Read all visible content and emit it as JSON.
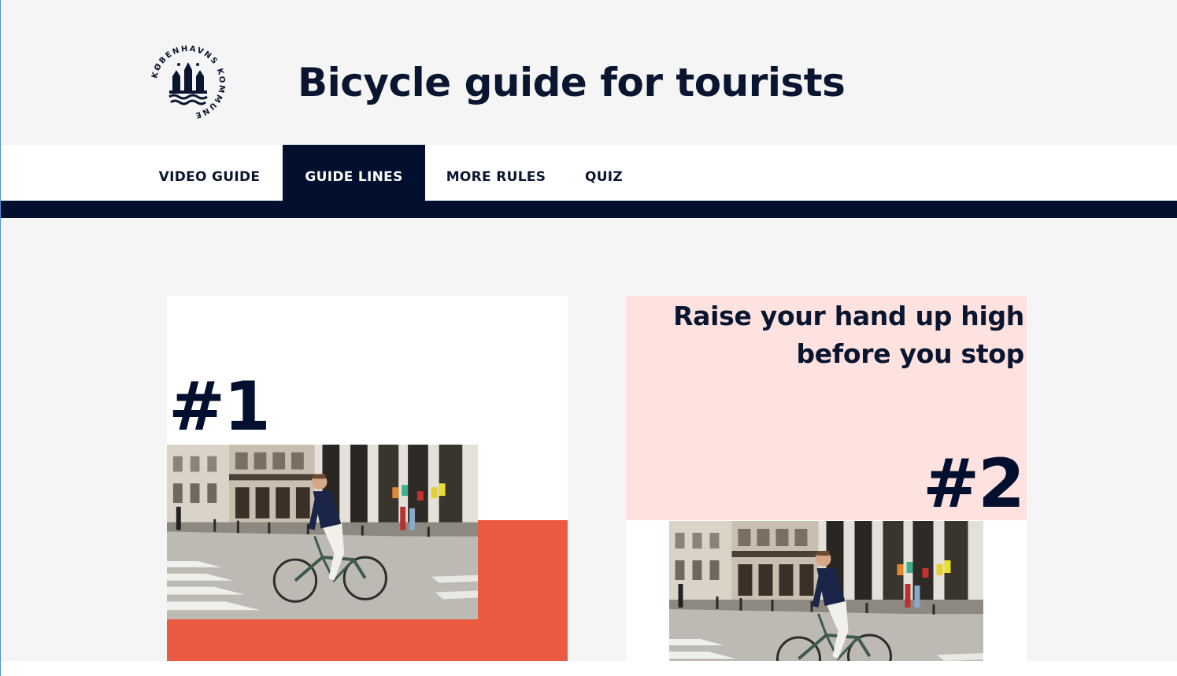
{
  "header": {
    "title": "Bicycle guide for tourists",
    "logo_text": "KØBENHAVNS KOMMUNE"
  },
  "nav": {
    "tabs": [
      {
        "label": "VIDEO GUIDE",
        "active": false
      },
      {
        "label": "GUIDE LINES",
        "active": true
      },
      {
        "label": "MORE RULES",
        "active": false
      },
      {
        "label": "QUIZ",
        "active": false
      }
    ]
  },
  "cards": [
    {
      "number": "#1",
      "text": "",
      "image": "cyclist-photo"
    },
    {
      "number": "#2",
      "text_line1": "Raise your hand up high",
      "text_line2": "before you stop",
      "image": "cyclist-photo"
    }
  ],
  "colors": {
    "navy": "#020f2e",
    "accent_orange": "#ea5a40",
    "pink": "#fde2df",
    "background": "#f5f5f5"
  }
}
